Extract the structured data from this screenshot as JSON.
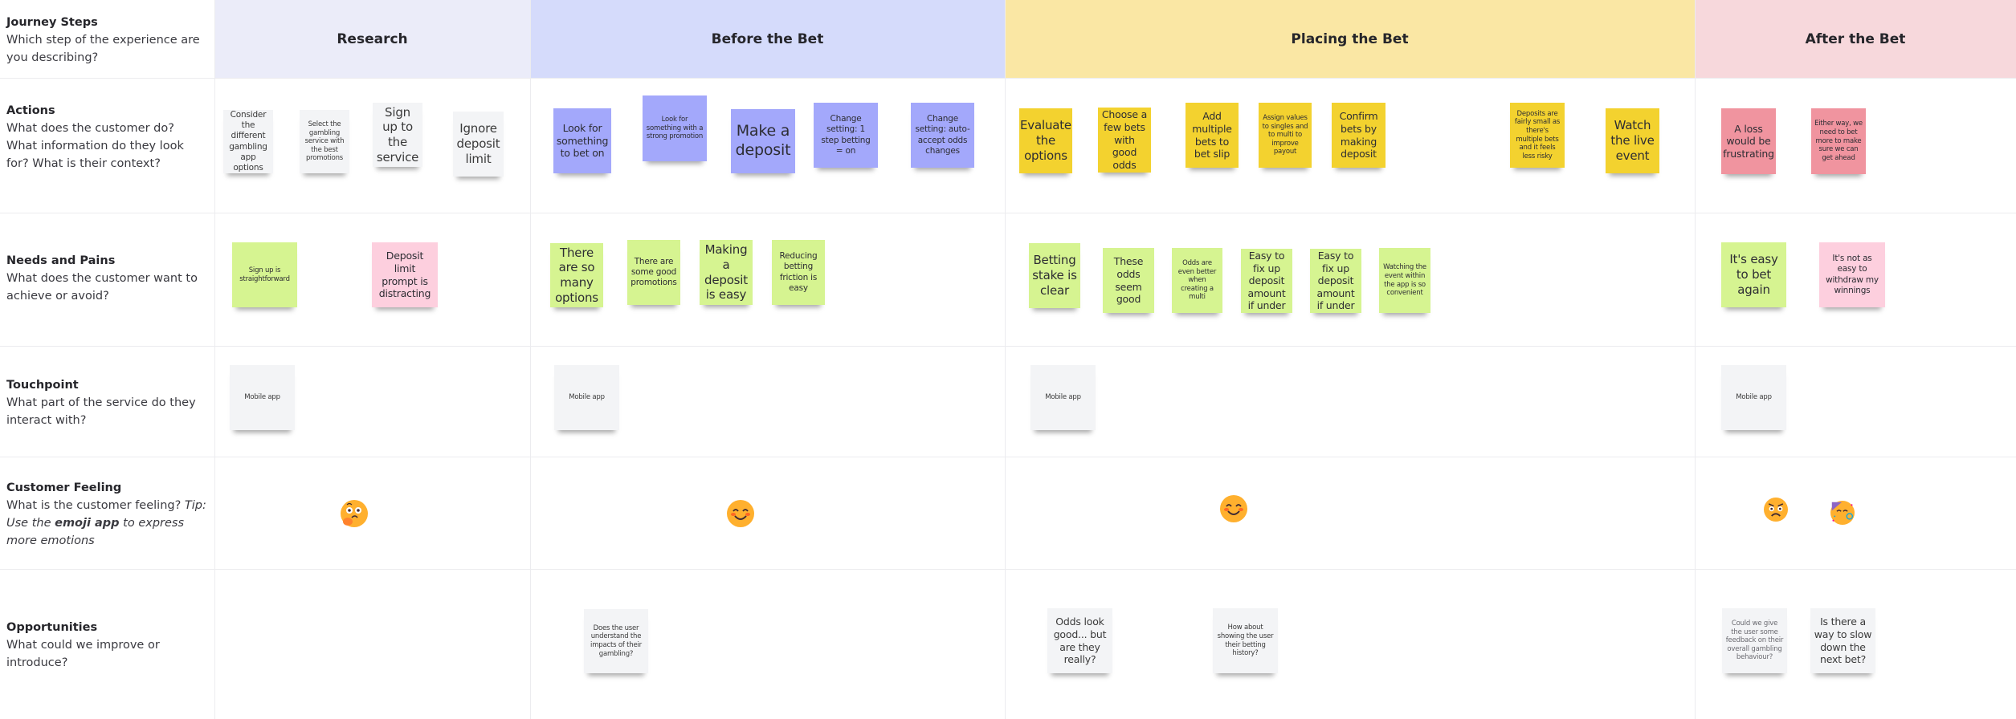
{
  "stages": [
    {
      "label": "Research",
      "color": "#ebecf9"
    },
    {
      "label": "Before the Bet",
      "color": "#d5dbfb"
    },
    {
      "label": "Placing the Bet",
      "color": "#fae7a4"
    },
    {
      "label": "After the Bet",
      "color": "#f7d8dc"
    }
  ],
  "rows": {
    "journey": {
      "title": "Journey Steps",
      "question": "Which step of the experience are you describing?"
    },
    "actions": {
      "title": "Actions",
      "question": "What does the customer do? What information do they look for? What is their context?"
    },
    "needs": {
      "title": "Needs and Pains",
      "question": "What does the customer want to achieve or avoid?"
    },
    "touchpoint": {
      "title": "Touchpoint",
      "question": "What part of the service do they interact with?"
    },
    "feeling": {
      "title": "Customer Feeling",
      "question": "What is the customer feeling?",
      "tip_prefix": "Tip:",
      "tip_use": "Use the",
      "tip_app": "emoji app",
      "tip_suffix": "to express more emotions"
    },
    "opportunities": {
      "title": "Opportunities",
      "question": "What could we improve or introduce?"
    }
  },
  "actions": {
    "research": [
      "Consider the different gambling app options",
      "Select the gambling service with the best promotions",
      "Sign up to the service",
      "Ignore deposit limit"
    ],
    "before": [
      "Look for something to bet on",
      "Look for something with a strong promotion",
      "Make a deposit",
      "Change setting: 1 step betting = on",
      "Change setting: auto-accept odds changes"
    ],
    "placing": [
      "Evaluate the options",
      "Choose a few bets with good odds",
      "Add multiple bets to bet slip",
      "Assign values to singles and to multi to improve payout",
      "Confirm bets by making deposit",
      "Deposits are fairly small as there's multiple bets and it feels less risky",
      "Watch the live event"
    ],
    "after": [
      "A loss would be frustrating",
      "Either way, we need to bet more to make sure we can get ahead"
    ]
  },
  "needs": {
    "research": [
      "Sign up is straightforward",
      "Deposit limit prompt is distracting"
    ],
    "before": [
      "There are so many options",
      "There are some good promotions",
      "Making a deposit is easy",
      "Reducing betting friction is easy"
    ],
    "placing": [
      "Betting stake is clear",
      "These odds seem good",
      "Odds are even better when creating a multi",
      "Easy to fix up deposit amount if under",
      "Easy to fix up deposit amount if under",
      "Watching the event within the app is so convenient"
    ],
    "after": [
      "It's easy to bet again",
      "It's not as easy to withdraw my winnings"
    ]
  },
  "touchpoints": {
    "research": "Mobile app",
    "before": "Mobile app",
    "placing": "Mobile app",
    "after": "Mobile app"
  },
  "feelings": {
    "research": [
      "thinking-face-icon"
    ],
    "before": [
      "smiling-face-icon"
    ],
    "placing": [
      "smiling-face-icon"
    ],
    "after": [
      "angry-face-icon",
      "partying-face-icon"
    ]
  },
  "opportunities": {
    "before": [
      "Does the user understand the impacts of their gambling?"
    ],
    "placing": [
      "Odds look good... but are they really?",
      "How about showing the user their betting history?"
    ],
    "after": [
      "Could we give the user some feedback on their overall gambling behaviour?",
      "Is there a way to slow down the next bet?"
    ]
  }
}
